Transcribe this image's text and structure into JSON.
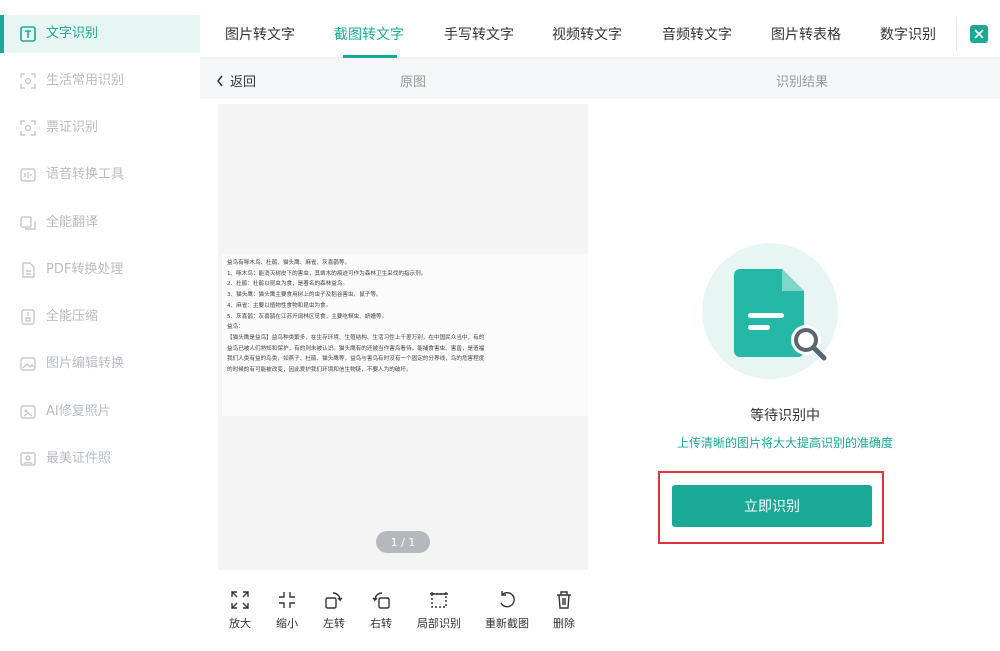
{
  "sidebar": {
    "items": [
      {
        "label": "文字识别",
        "icon": "text-recognition-icon"
      },
      {
        "label": "生活常用识别",
        "icon": "scan-icon"
      },
      {
        "label": "票证识别",
        "icon": "ticket-scan-icon"
      },
      {
        "label": "语音转换工具",
        "icon": "voice-icon"
      },
      {
        "label": "全能翻译",
        "icon": "translate-icon"
      },
      {
        "label": "PDF转换处理",
        "icon": "pdf-icon"
      },
      {
        "label": "全能压缩",
        "icon": "compress-icon"
      },
      {
        "label": "图片编辑转换",
        "icon": "image-edit-icon"
      },
      {
        "label": "AI修复照片",
        "icon": "ai-repair-icon"
      },
      {
        "label": "最美证件照",
        "icon": "id-photo-icon"
      }
    ]
  },
  "tabs": [
    {
      "label": "图片转文字"
    },
    {
      "label": "截图转文字"
    },
    {
      "label": "手写转文字"
    },
    {
      "label": "视频转文字"
    },
    {
      "label": "音频转文字"
    },
    {
      "label": "图片转表格"
    },
    {
      "label": "数字识别"
    }
  ],
  "subheader": {
    "back_label": "返回",
    "original_label": "原图",
    "result_label": "识别结果"
  },
  "document": {
    "lines": [
      "益鸟有啄木鸟、杜鹃、猫头鹰、麻雀、灰喜鹊等。",
      "1、啄木鸟：能消灭树皮下的害虫，其凿木的痕迹可作为森林卫生采伐的指示剂。",
      "2、杜鹃：杜鹃以昆虫为食，是著名的森林益鸟。",
      "3、猫头鹰：猫头鹰主要食用树上的虫子及稻谷害虫、鼠子等。",
      "4、麻雀：主要以植物性食物和昆虫为食。",
      "5、灰喜鹊：灰喜鹊在江苏开阔林区觅食，主要吃螟虫、蛴螬等。",
      "益鸟：",
      "【猫头鹰是益鸟】益鸟种类繁多，在生存环境、生殖结构、生活习性上千差万别，在中国民众当中，有的",
      "益鸟已被人们熟知和保护，有的则未被认识。猫头鹰有的还被当作害鸟看待，能捕食害虫、害兽，是造福",
      "我们人类有益的鸟类，如燕子、杜鹃、猫头鹰等，益鸟与害鸟有时没有一个固定的分界线，鸟的危害程度",
      "的时候的有可能被改变，因此爱护我们环境和信生物链，不要人为的破坏。"
    ]
  },
  "pagination": {
    "text": "1 / 1"
  },
  "toolbar": [
    {
      "label": "放大",
      "icon": "zoom-in-icon"
    },
    {
      "label": "缩小",
      "icon": "zoom-out-icon"
    },
    {
      "label": "左转",
      "icon": "rotate-left-icon"
    },
    {
      "label": "右转",
      "icon": "rotate-right-icon"
    },
    {
      "label": "局部识别",
      "icon": "partial-recognition-icon"
    },
    {
      "label": "重新截图",
      "icon": "retake-screenshot-icon"
    },
    {
      "label": "删除",
      "icon": "delete-icon"
    }
  ],
  "result": {
    "status_title": "等待识别中",
    "status_subtitle": "上传清晰的图片将大大提高识别的准确度",
    "button_label": "立即识别"
  },
  "colors": {
    "accent": "#1aa897",
    "highlight_border": "#e0333a"
  }
}
